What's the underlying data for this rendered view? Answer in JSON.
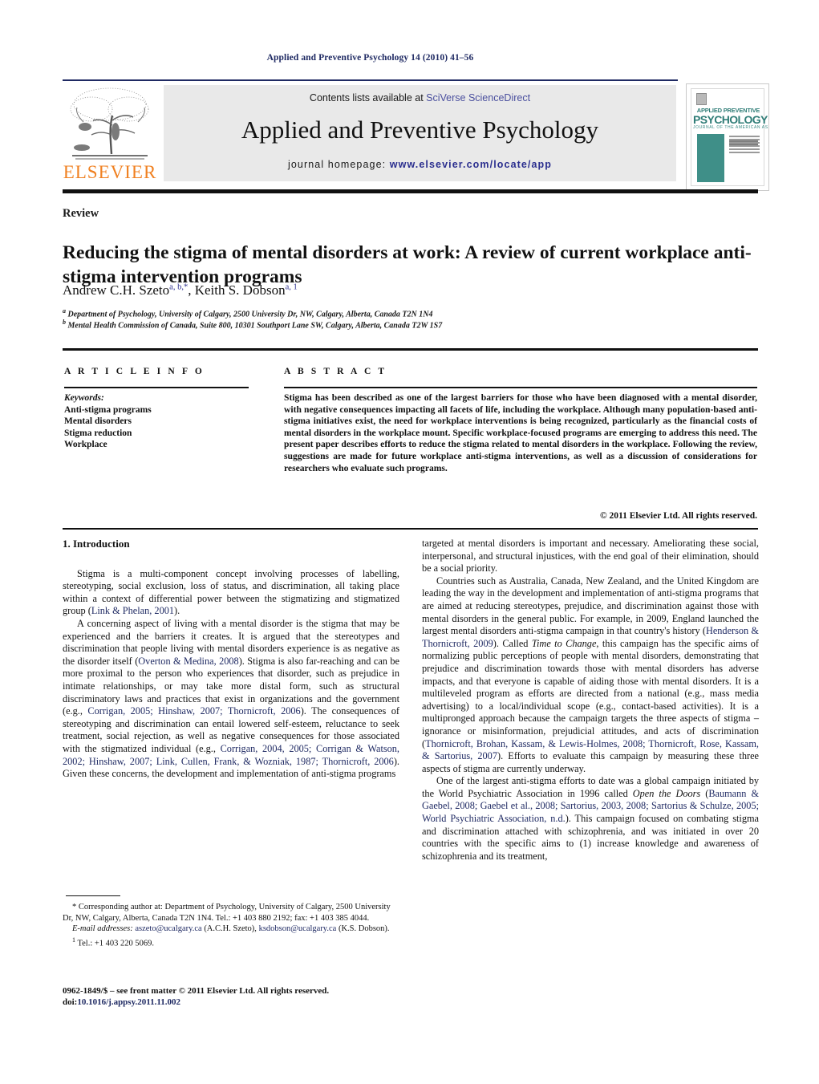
{
  "running_head": "Applied and Preventive Psychology 14 (2010) 41–56",
  "masthead": {
    "publisher_logo_label": "ELSEVIER",
    "contents_prefix": "Contents lists available at ",
    "contents_link": "SciVerse ScienceDirect",
    "journal_name": "Applied and Preventive Psychology",
    "homepage_label": "journal homepage: ",
    "homepage_url": "www.elsevier.com/locate/app",
    "cover": {
      "title_line1": "APPLIED      PREVENTIVE",
      "title_line2": "PSYCHOLOGY",
      "subtitle": "JOURNAL OF THE AMERICAN ASSOCIATION OF APPLIED AND PREVENTIVE PSYCHOLOGY",
      "accent_color": "#3f8f88"
    },
    "accent_link_color": "#2b2f8f",
    "elsevier_orange": "#f08122"
  },
  "article": {
    "type": "Review",
    "title": "Reducing the stigma of mental disorders at work: A review of current workplace anti-stigma intervention programs",
    "authors_html": "Andrew C.H. Szeto<sup>a, b,</sup><sup>*</sup>, Keith S. Dobson<sup>a, 1</sup>",
    "affiliation_a": "Department of Psychology, University of Calgary, 2500 University Dr, NW, Calgary, Alberta, Canada T2N 1N4",
    "affiliation_b": "Mental Health Commission of Canada, Suite 800, 10301 Southport Lane SW, Calgary, Alberta, Canada T2W 1S7"
  },
  "article_info": {
    "heading": "A R T I C L E    I N F O",
    "keywords_label": "Keywords:",
    "keywords": [
      "Anti-stigma programs",
      "Mental disorders",
      "Stigma reduction",
      "Workplace"
    ]
  },
  "abstract": {
    "heading": "A B S T R A C T",
    "text": "Stigma has been described as one of the largest barriers for those who have been diagnosed with a mental disorder, with negative consequences impacting all facets of life, including the workplace. Although many population-based anti-stigma initiatives exist, the need for workplace interventions is being recognized, particularly as the financial costs of mental disorders in the workplace mount. Specific workplace-focused programs are emerging to address this need. The present paper describes efforts to reduce the stigma related to mental disorders in the workplace. Following the review, suggestions are made for future workplace anti-stigma interventions, as well as a discussion of considerations for researchers who evaluate such programs.",
    "copyright": "© 2011 Elsevier Ltd. All rights reserved."
  },
  "body": {
    "section_number_title": "1.  Introduction",
    "left_paragraphs": [
      "Stigma is a multi-component concept involving processes of labelling, stereotyping, social exclusion, loss of status, and discrimination, all taking place within a context of differential power between the stigmatizing and stigmatized group (Link & Phelan, 2001).",
      "A concerning aspect of living with a mental disorder is the stigma that may be experienced and the barriers it creates. It is argued that the stereotypes and discrimination that people living with mental disorders experience is as negative as the disorder itself (Overton & Medina, 2008). Stigma is also far-reaching and can be more proximal to the person who experiences that disorder, such as prejudice in intimate relationships, or may take more distal form, such as structural discriminatory laws and practices that exist in organizations and the government (e.g., Corrigan, 2005; Hinshaw, 2007; Thornicroft, 2006). The consequences of stereotyping and discrimination can entail lowered self-esteem, reluctance to seek treatment, social rejection, as well as negative consequences for those associated with the stigmatized individual (e.g., Corrigan, 2004, 2005; Corrigan & Watson, 2002; Hinshaw, 2007; Link, Cullen, Frank, & Wozniak, 1987; Thornicroft, 2006). Given these concerns, the development and implementation of anti-stigma programs"
    ],
    "right_paragraphs": [
      "targeted at mental disorders is important and necessary. Ameliorating these social, interpersonal, and structural injustices, with the end goal of their elimination, should be a social priority.",
      "Countries such as Australia, Canada, New Zealand, and the United Kingdom are leading the way in the development and implementation of anti-stigma programs that are aimed at reducing stereotypes, prejudice, and discrimination against those with mental disorders in the general public. For example, in 2009, England launched the largest mental disorders anti-stigma campaign in that country's history (Henderson & Thornicroft, 2009). Called Time to Change, this campaign has the specific aims of normalizing public perceptions of people with mental disorders, demonstrating that prejudice and discrimination towards those with mental disorders has adverse impacts, and that everyone is capable of aiding those with mental disorders. It is a multileveled program as efforts are directed from a national (e.g., mass media advertising) to a local/individual scope (e.g., contact-based activities). It is a multipronged approach because the campaign targets the three aspects of stigma – ignorance or misinformation, prejudicial attitudes, and acts of discrimination (Thornicroft, Brohan, Kassam, & Lewis-Holmes, 2008; Thornicroft, Rose, Kassam, & Sartorius, 2007). Efforts to evaluate this campaign by measuring these three aspects of stigma are currently underway.",
      "One of the largest anti-stigma efforts to date was a global campaign initiated by the World Psychiatric Association in 1996 called Open the Doors (Baumann & Gaebel, 2008; Gaebel et al., 2008; Sartorius, 2003, 2008; Sartorius & Schulze, 2005; World Psychiatric Association, n.d.). This campaign focused on combating stigma and discrimination attached with schizophrenia, and was initiated in over 20 countries with the specific aims to (1) increase knowledge and awareness of schizophrenia and its treatment,"
    ]
  },
  "footnotes": {
    "corresponding": "* Corresponding author at: Department of Psychology, University of Calgary, 2500 University Dr, NW, Calgary, Alberta, Canada T2N 1N4. Tel.: +1 403 880 2192; fax: +1 403 385 4044.",
    "email_label": "E-mail addresses:",
    "email_1": "aszeto@ucalgary.ca",
    "email_1_owner": "(A.C.H. Szeto),",
    "email_2": "ksdobson@ucalgary.ca",
    "email_2_owner": "(K.S. Dobson).",
    "tel_note": "Tel.: +1 403 220 5069.",
    "tel_marker": "1"
  },
  "imprint": {
    "front_matter": "0962-1849/$ – see front matter © 2011 Elsevier Ltd. All rights reserved.",
    "doi_label": "doi:",
    "doi_value": "10.1016/j.appsy.2011.11.002"
  }
}
